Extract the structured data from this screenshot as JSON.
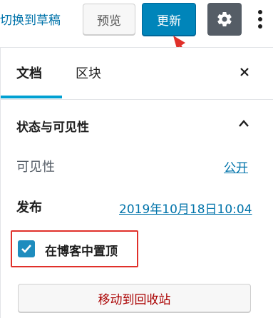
{
  "toolbar": {
    "switch_to_draft": "切换到草稿",
    "preview_label": "预览",
    "update_label": "更新",
    "settings_icon": "gear-icon",
    "more_icon": "vertical-ellipsis-icon"
  },
  "sidebar": {
    "tabs": [
      {
        "label": "文档",
        "active": true
      },
      {
        "label": "区块",
        "active": false
      }
    ],
    "close_icon": "close-icon"
  },
  "status_panel": {
    "title": "状态与可见性",
    "visibility_label": "可见性",
    "visibility_value": "公开",
    "publish_label": "发布",
    "publish_value": "2019年10月18日10:04",
    "sticky_label": "在博客中置顶",
    "sticky_checked": true,
    "trash_label": "移动到回收站"
  },
  "colors": {
    "accent": "#0085ba",
    "link": "#0073aa",
    "highlight": "#e0302a",
    "danger": "#a00000"
  }
}
